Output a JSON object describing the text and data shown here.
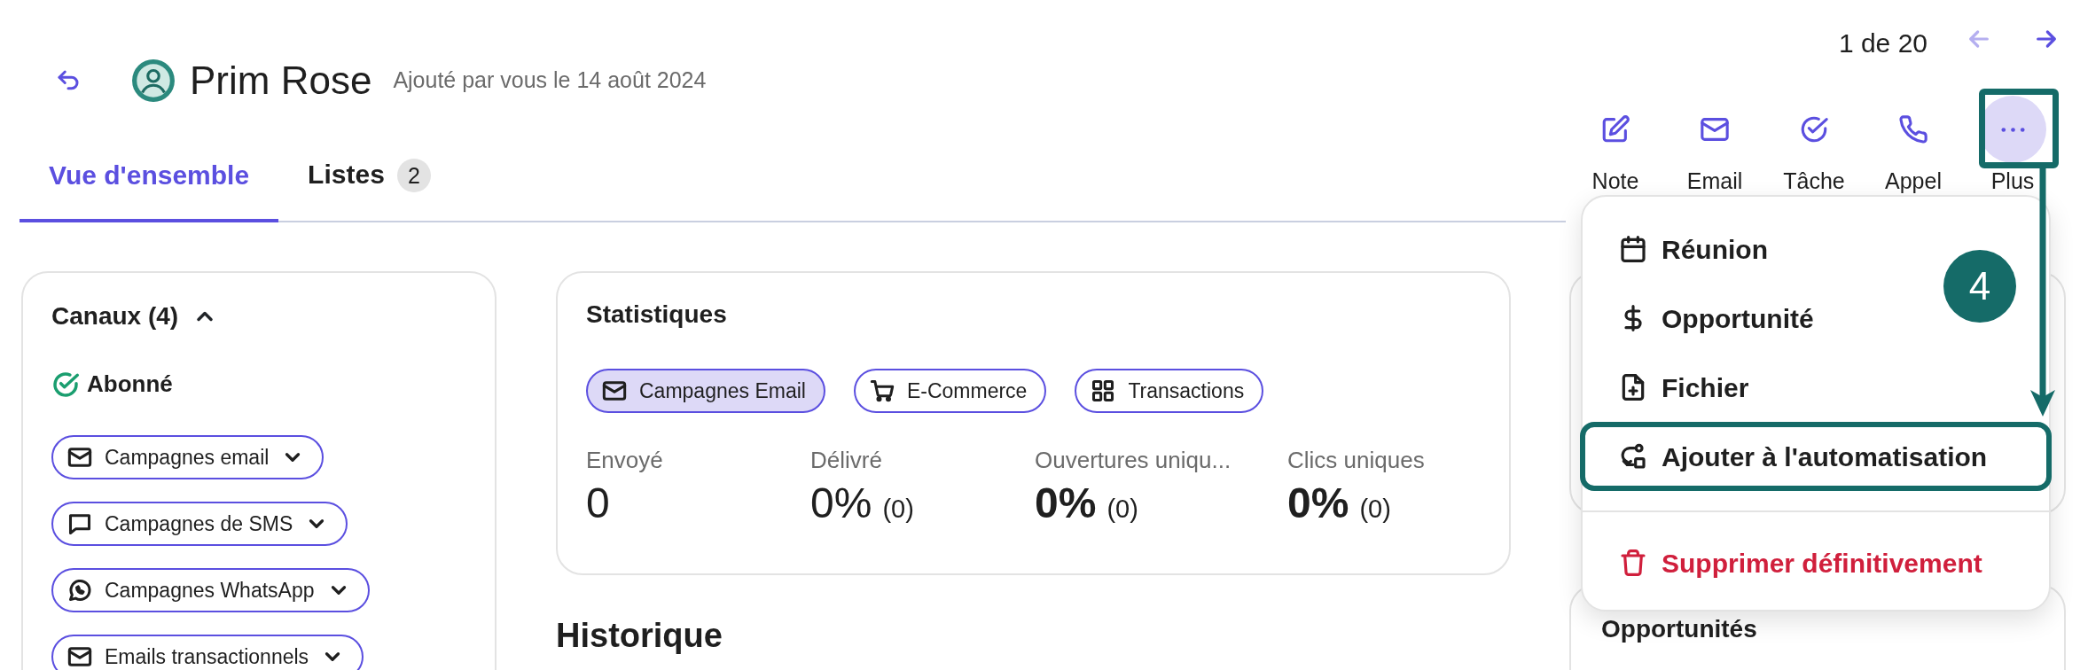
{
  "header": {
    "title": "Prim Rose",
    "subtitle": "Ajouté par vous le 14 août 2024"
  },
  "pager": {
    "text": "1 de 20",
    "prev": {
      "disabled": true
    },
    "next": {
      "disabled": false
    }
  },
  "actions": [
    {
      "kind": "note",
      "label": "Note",
      "selected": false
    },
    {
      "kind": "email",
      "label": "Email",
      "selected": false
    },
    {
      "kind": "task",
      "label": "Tâche",
      "selected": false
    },
    {
      "kind": "call",
      "label": "Appel",
      "selected": false
    },
    {
      "kind": "more",
      "label": "Plus",
      "selected": true
    }
  ],
  "tabs": [
    {
      "label": "Vue d'ensemble",
      "selected": true
    },
    {
      "label": "Listes",
      "count": "2",
      "selected": false
    }
  ],
  "channels": {
    "title": "Canaux (4)",
    "expanded": true,
    "status": "Abonné",
    "items": [
      {
        "kind": "email",
        "label": "Campagnes email"
      },
      {
        "kind": "sms",
        "label": "Campagnes de SMS"
      },
      {
        "kind": "whatsapp",
        "label": "Campagnes WhatsApp"
      },
      {
        "kind": "email",
        "label": "Emails transactionnels"
      }
    ]
  },
  "statistics": {
    "title": "Statistiques",
    "filters": [
      {
        "kind": "email",
        "label": "Campagnes Email",
        "selected": true
      },
      {
        "kind": "cart",
        "label": "E-Commerce",
        "selected": false
      },
      {
        "kind": "grid",
        "label": "Transactions",
        "selected": false
      }
    ],
    "metrics": [
      {
        "label": "Envoyé",
        "value": "0",
        "bold": false
      },
      {
        "label": "Délivré",
        "value": "0%",
        "count": "(0)",
        "bold": false
      },
      {
        "label": "Ouvertures uniqu...",
        "value": "0%",
        "count": "(0)",
        "bold": true
      },
      {
        "label": "Clics uniques",
        "value": "0%",
        "count": "(0)",
        "bold": true
      }
    ]
  },
  "history": {
    "title": "Historique"
  },
  "side": {
    "opportunities_title": "Opportunités"
  },
  "menu": {
    "items": [
      {
        "kind": "calendar",
        "label": "Réunion",
        "highlighted": false,
        "danger": false
      },
      {
        "kind": "dollar",
        "label": "Opportunité",
        "highlighted": false,
        "danger": false
      },
      {
        "kind": "file",
        "label": "Fichier",
        "highlighted": false,
        "danger": false
      },
      {
        "kind": "automation",
        "label": "Ajouter à l'automatisation",
        "highlighted": true,
        "danger": false
      },
      {
        "kind": "trash",
        "label": "Supprimer définitivement",
        "highlighted": false,
        "danger": true
      }
    ]
  },
  "annotation": {
    "step": "4"
  }
}
